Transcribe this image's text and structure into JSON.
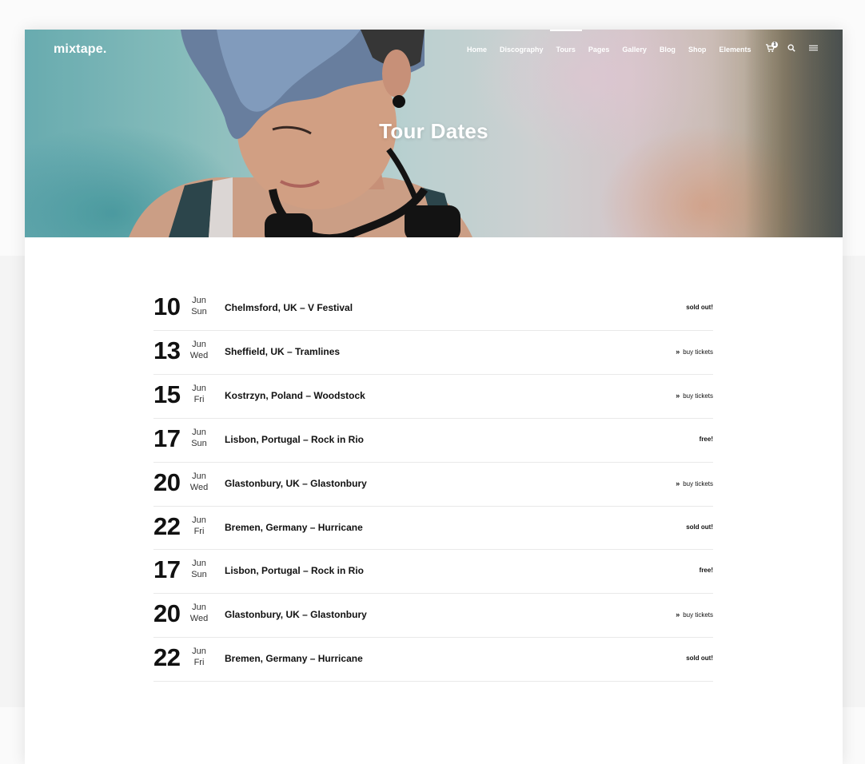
{
  "site": {
    "logo": "mixtape."
  },
  "nav": {
    "items": [
      {
        "label": "Home"
      },
      {
        "label": "Discography"
      },
      {
        "label": "Tours"
      },
      {
        "label": "Pages"
      },
      {
        "label": "Gallery"
      },
      {
        "label": "Blog"
      },
      {
        "label": "Shop"
      },
      {
        "label": "Elements"
      }
    ],
    "active": "Tours",
    "cart_count": "1",
    "icons": [
      "cart-icon",
      "search-icon",
      "menu-icon"
    ]
  },
  "hero": {
    "title": "Tour Dates"
  },
  "tours": [
    {
      "day": "10",
      "month": "Jun",
      "weekday": "Sun",
      "venue": "Chelmsford, UK – V Festival",
      "status": "sold out!",
      "type": "text"
    },
    {
      "day": "13",
      "month": "Jun",
      "weekday": "Wed",
      "venue": "Sheffield, UK – Tramlines",
      "status": "buy tickets",
      "type": "link"
    },
    {
      "day": "15",
      "month": "Jun",
      "weekday": "Fri",
      "venue": "Kostrzyn, Poland – Woodstock",
      "status": "buy tickets",
      "type": "link"
    },
    {
      "day": "17",
      "month": "Jun",
      "weekday": "Sun",
      "venue": "Lisbon, Portugal – Rock in Rio",
      "status": "free!",
      "type": "text"
    },
    {
      "day": "20",
      "month": "Jun",
      "weekday": "Wed",
      "venue": "Glastonbury, UK – Glastonbury",
      "status": "buy tickets",
      "type": "link"
    },
    {
      "day": "22",
      "month": "Jun",
      "weekday": "Fri",
      "venue": "Bremen, Germany – Hurricane",
      "status": "sold out!",
      "type": "text"
    },
    {
      "day": "17",
      "month": "Jun",
      "weekday": "Sun",
      "venue": "Lisbon, Portugal – Rock in Rio",
      "status": "free!",
      "type": "text"
    },
    {
      "day": "20",
      "month": "Jun",
      "weekday": "Wed",
      "venue": "Glastonbury, UK – Glastonbury",
      "status": "buy tickets",
      "type": "link"
    },
    {
      "day": "22",
      "month": "Jun",
      "weekday": "Fri",
      "venue": "Bremen, Germany – Hurricane",
      "status": "sold out!",
      "type": "text"
    }
  ],
  "colors": {
    "accent": "#ffffff",
    "text": "#111111",
    "divider": "#e9e9e9"
  }
}
